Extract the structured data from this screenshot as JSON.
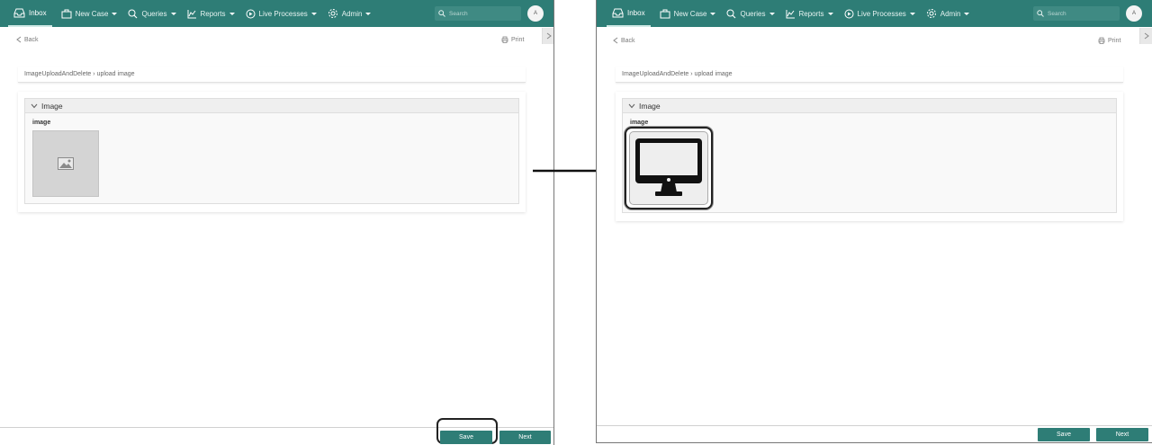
{
  "nav": {
    "inbox": "Inbox",
    "new_case": "New Case",
    "queries": "Queries",
    "reports": "Reports",
    "live_processes": "Live Processes",
    "admin": "Admin",
    "search_placeholder": "Search",
    "avatar_initial": "A"
  },
  "page": {
    "back": "Back",
    "print": "Print",
    "breadcrumb": "ImageUploadAndDelete › upload image",
    "section_title": "Image",
    "field_label": "image"
  },
  "footer": {
    "save": "Save",
    "next": "Next"
  },
  "colors": {
    "brand": "#2e7d76"
  },
  "icons": [
    "inbox-icon",
    "new-case-icon",
    "search-icon",
    "reports-icon",
    "live-processes-icon",
    "gear-icon",
    "printer-icon",
    "chevron-left-icon",
    "chevron-down-icon",
    "chevron-right-icon",
    "image-placeholder-icon",
    "monitor-icon",
    "arrow-right-icon"
  ]
}
